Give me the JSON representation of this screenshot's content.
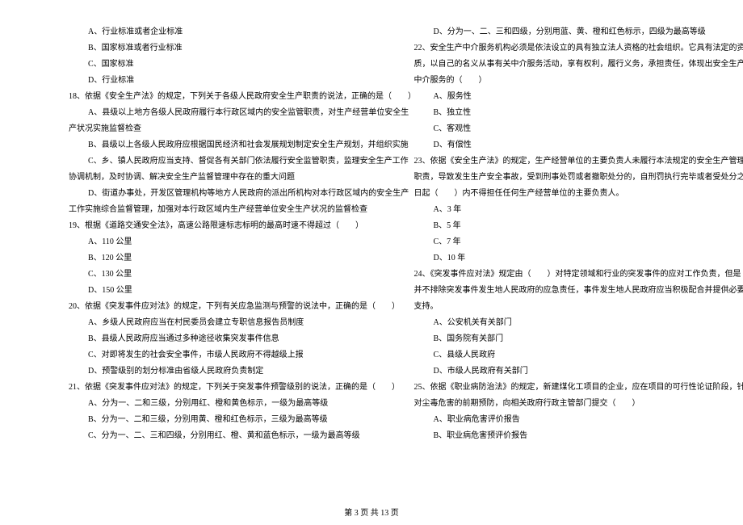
{
  "col1": {
    "q17_opts": [
      "A、行业标准或者企业标准",
      "B、国家标准或者行业标准",
      "C、国家标准",
      "D、行业标准"
    ],
    "q18_stem": "18、依据《安全生产法》的规定，下列关于各级人民政府安全生产职责的说法，正确的是（　　）",
    "q18_opts": [
      "A、县级以上地方各级人民政府履行本行政区域内的安全监管职责，对生产经营单位安全生",
      "产状况实施监督检查",
      "B、县级以上各级人民政府应根据国民经济和社会发展规划制定安全生产规划，并组织实施",
      "C、乡、镇人民政府应当支持、督促各有关部门依法履行安全监管职责，监理安全生产工作",
      "协调机制，及时协调、解决安全生产监督管理中存在的重大问题",
      "D、街道办事处，开发区管理机构等地方人民政府的派出所机构对本行政区域内的安全生产",
      "工作实施综合监督管理，加强对本行政区域内生产经营单位安全生产状况的监督检查"
    ],
    "q19_stem": "19、根据《道路交通安全法》，高速公路限速标志标明的最高时速不得超过（　　）",
    "q19_opts": [
      "A、110 公里",
      "B、120 公里",
      "C、130 公里",
      "D、150 公里"
    ],
    "q20_stem": "20、依据《突发事件应对法》的规定，下列有关应急监测与预警的说法中，正确的是（　　）",
    "q20_opts": [
      "A、乡级人民政府应当在村民委员会建立专职信息报告员制度",
      "B、县级人民政府应当通过多种途径收集突发事件信息",
      "C、对即将发生的社会安全事件，市级人民政府不得越级上报",
      "D、预警级别的划分标准由省级人民政府负责制定"
    ],
    "q21_stem": "21、依据《突发事件应对法》的规定，下列关于突发事件预警级别的说法，正确的是（　　）",
    "q21_opts": [
      "A、分为一、二和三级，分别用红、橙和黄色标示，一级为最高等级",
      "B、分为一、二和三级，分别用黄、橙和红色标示，三级为最高等级",
      "C、分为一、二、三和四级，分别用红、橙、黄和蓝色标示，一级为最高等级"
    ]
  },
  "col2": {
    "q21_opt_d": "D、分为一、二、三和四级，分别用蓝、黄、橙和红色标示，四级为最高等级",
    "q22_stem_1": "22、安全生产中介服务机构必须是依法设立的具有独立法人资格的社会组织。它具有法定的资",
    "q22_stem_2": "质，以自己的名义从事有关中介服务活动，享有权利，履行义务，承担责任，体现出安全生产",
    "q22_stem_3": "中介服务的（　　）",
    "q22_opts": [
      "A、服务性",
      "B、独立性",
      "C、客观性",
      "D、有偿性"
    ],
    "q23_stem_1": "23、依据《安全生产法》的规定，生产经营单位的主要负责人未履行本法规定的安全生产管理",
    "q23_stem_2": "职责，导致发生生产安全事故，受到刑事处罚或者撤职处分的，自刑罚执行完毕或者受处分之",
    "q23_stem_3": "日起（　　）内不得担任任何生产经营单位的主要负责人。",
    "q23_opts": [
      "A、3 年",
      "B、5 年",
      "C、7 年",
      "D、10 年"
    ],
    "q24_stem_1": "24、《突发事件应对法》规定由（　　）对特定领域和行业的突发事件的应对工作负责，但是",
    "q24_stem_2": "并不排除突发事件发生地人民政府的应急责任，事件发生地人民政府应当积极配合并提供必要",
    "q24_stem_3": "支持。",
    "q24_opts": [
      "A、公安机关有关部门",
      "B、国务院有关部门",
      "C、县级人民政府",
      "D、市级人民政府有关部门"
    ],
    "q25_stem_1": "25、依据《职业病防治法》的规定，新建煤化工项目的企业，应在项目的可行性论证阶段，针",
    "q25_stem_2": "对尘毒危害的前期预防，向相关政府行政主管部门提交（　　）",
    "q25_opts": [
      "A、职业病危害评价报告",
      "B、职业病危害预评价报告"
    ]
  },
  "footer": "第 3 页 共 13 页"
}
